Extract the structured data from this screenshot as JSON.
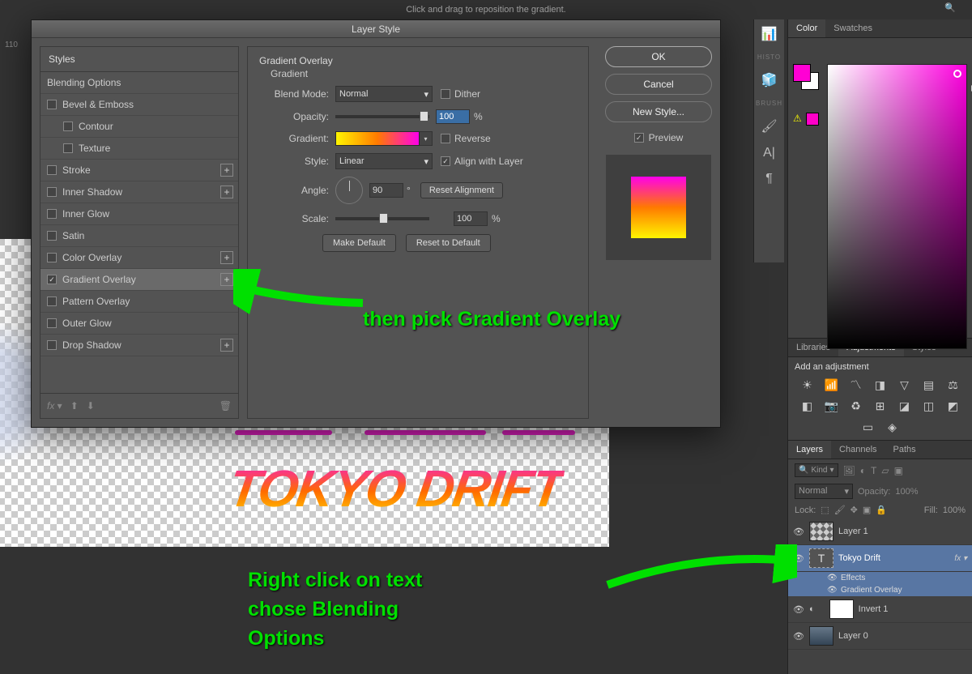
{
  "topbar": {
    "hint": "Click and drag to reposition the gradient."
  },
  "ruler": {
    "mark": "110"
  },
  "collapse": "▸▸",
  "dialog": {
    "title": "Layer Style",
    "stylesHeader": "Styles",
    "blendingOptions": "Blending Options",
    "items": [
      {
        "label": "Bevel & Emboss",
        "checked": false,
        "plus": false
      },
      {
        "label": "Contour",
        "checked": false,
        "plus": false,
        "sub": true
      },
      {
        "label": "Texture",
        "checked": false,
        "plus": false,
        "sub": true
      },
      {
        "label": "Stroke",
        "checked": false,
        "plus": true
      },
      {
        "label": "Inner Shadow",
        "checked": false,
        "plus": true
      },
      {
        "label": "Inner Glow",
        "checked": false,
        "plus": false
      },
      {
        "label": "Satin",
        "checked": false,
        "plus": false
      },
      {
        "label": "Color Overlay",
        "checked": false,
        "plus": true
      },
      {
        "label": "Gradient Overlay",
        "checked": true,
        "plus": true,
        "selected": true
      },
      {
        "label": "Pattern Overlay",
        "checked": false,
        "plus": false
      },
      {
        "label": "Outer Glow",
        "checked": false,
        "plus": false
      },
      {
        "label": "Drop Shadow",
        "checked": false,
        "plus": true
      }
    ],
    "footer": {
      "fx": "fx"
    },
    "settings": {
      "title": "Gradient Overlay",
      "subtitle": "Gradient",
      "blendModeLabel": "Blend Mode:",
      "blendMode": "Normal",
      "dither": "Dither",
      "opacityLabel": "Opacity:",
      "opacity": "100",
      "pct": "%",
      "gradientLabel": "Gradient:",
      "reverse": "Reverse",
      "styleLabel": "Style:",
      "style": "Linear",
      "align": "Align with Layer",
      "angleLabel": "Angle:",
      "angle": "90",
      "deg": "°",
      "resetAlign": "Reset Alignment",
      "scaleLabel": "Scale:",
      "scale": "100",
      "makeDefault": "Make Default",
      "resetDefault": "Reset to Default"
    },
    "right": {
      "ok": "OK",
      "cancel": "Cancel",
      "newStyle": "New Style...",
      "preview": "Preview"
    }
  },
  "canvas": {
    "text": "TOKYO DRIFT"
  },
  "annotations": {
    "a1": "then pick Gradient Overlay",
    "a2a": "Right click on text",
    "a2b": "chose Blending",
    "a2c": "Options"
  },
  "toolstrip": {
    "g1": "HISTO",
    "g2": "BRUSH"
  },
  "rightPanel": {
    "colorTab": "Color",
    "swatchesTab": "Swatches",
    "libTab": "Libraries",
    "adjTab": "Adjustments",
    "stylesTab": "Styles",
    "addAdj": "Add an adjustment",
    "layersTab": "Layers",
    "channelsTab": "Channels",
    "pathsTab": "Paths",
    "kind": "Kind",
    "normal": "Normal",
    "opacityLabel": "Opacity:",
    "opacity": "100%",
    "lock": "Lock:",
    "fillLabel": "Fill:",
    "fill": "100%",
    "layers": [
      {
        "name": "Layer 1",
        "type": "chk"
      },
      {
        "name": "Tokyo Drift",
        "type": "T",
        "fx": "fx",
        "selected": true
      },
      {
        "name": "Effects",
        "sub": true
      },
      {
        "name": "Gradient Overlay",
        "sub": true
      },
      {
        "name": "Invert 1",
        "type": "white",
        "adj": true
      },
      {
        "name": "Layer 0",
        "type": "img"
      }
    ]
  }
}
